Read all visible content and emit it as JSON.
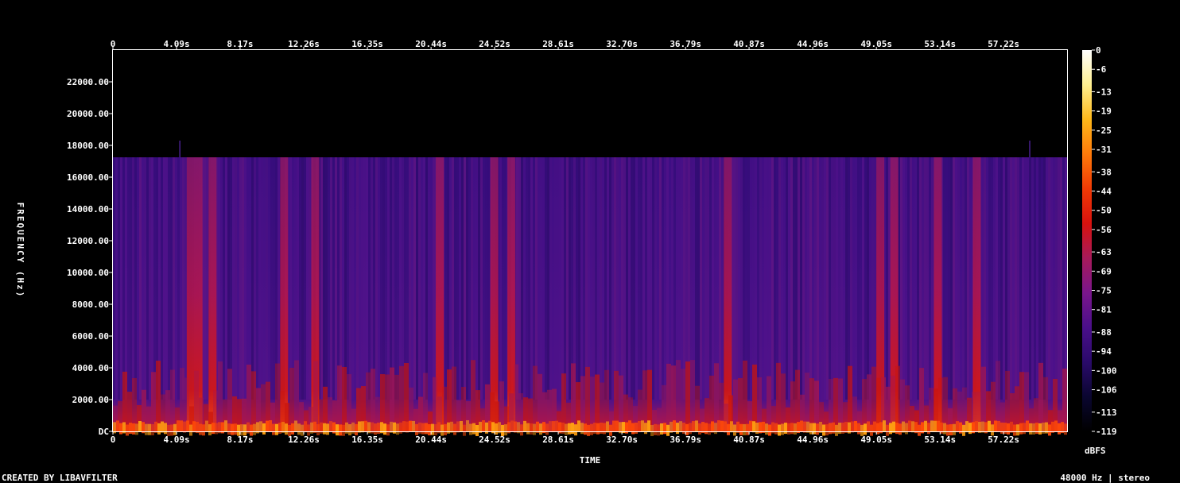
{
  "chart_data": {
    "type": "heatmap",
    "title": "",
    "xlabel": "TIME",
    "ylabel": "FREQUENCY (Hz)",
    "x_ticks": [
      "0",
      "4.09s",
      "8.17s",
      "12.26s",
      "16.35s",
      "20.44s",
      "24.52s",
      "28.61s",
      "32.70s",
      "36.79s",
      "40.87s",
      "44.96s",
      "49.05s",
      "53.14s",
      "57.22s"
    ],
    "x_tick_seconds": [
      0,
      4.09,
      8.17,
      12.26,
      16.35,
      20.44,
      24.52,
      28.61,
      32.7,
      36.79,
      40.87,
      44.96,
      49.05,
      53.14,
      57.22
    ],
    "x_range_seconds": [
      0,
      61.3
    ],
    "y_ticks": [
      "DC",
      "2000.00",
      "4000.00",
      "6000.00",
      "8000.00",
      "10000.00",
      "12000.00",
      "14000.00",
      "16000.00",
      "18000.00",
      "20000.00",
      "22000.00"
    ],
    "y_tick_hz": [
      0,
      2000,
      4000,
      6000,
      8000,
      10000,
      12000,
      14000,
      16000,
      18000,
      20000,
      22000
    ],
    "y_range_hz": [
      0,
      24000
    ],
    "content_cutoff_hz": 17250,
    "colorbar": {
      "unit": "dBFS",
      "ticks": [
        0,
        -6,
        -13,
        -19,
        -25,
        -31,
        -38,
        -44,
        -50,
        -56,
        -63,
        -69,
        -75,
        -81,
        -88,
        -94,
        -100,
        -106,
        -113,
        -119
      ],
      "range": [
        -119,
        0
      ],
      "palette": [
        "#000000",
        "#0a0630",
        "#2a0a6a",
        "#4a0f8a",
        "#7a168c",
        "#a81a5a",
        "#d8120e",
        "#f03a05",
        "#ff7a0a",
        "#ffb81a",
        "#fff090",
        "#ffffff"
      ]
    },
    "loud_band_seconds": [
      5.0,
      5.5,
      6.4,
      11.0,
      13.0,
      21.0,
      24.5,
      25.6,
      39.5,
      49.3,
      50.2,
      53.0,
      55.5
    ],
    "spike_seconds": [
      4.3,
      58.9
    ]
  },
  "footer": {
    "credit": "CREATED BY LIBAVFILTER",
    "info": "48000 Hz | stereo"
  }
}
